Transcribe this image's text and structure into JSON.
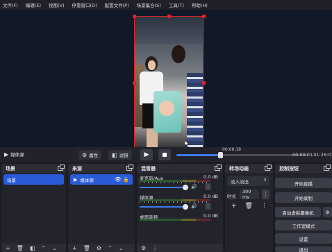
{
  "menu": [
    "文件(F)",
    "编辑(E)",
    "视图(V)",
    "停靠窗口(D)",
    "配置文件(P)",
    "场景集合(S)",
    "工具(T)",
    "帮助(H)"
  ],
  "transport": {
    "source_name": "媒体源",
    "properties_label": "属性",
    "filters_label": "滤镜",
    "hover_time": "00:00:19",
    "current_time": "00:00:01",
    "remaining_time": "-01:26:07",
    "progress": 0.33
  },
  "docks": {
    "scenes": {
      "title": "场景",
      "items": [
        "场景"
      ]
    },
    "sources": {
      "title": "来源",
      "items": [
        "媒体源"
      ]
    },
    "mixer": {
      "title": "混音器",
      "channels": [
        {
          "name": "麦克风/Aux",
          "db": "0.0 dB"
        },
        {
          "name": "媒体源",
          "db": "0.0 dB"
        },
        {
          "name": "桌面音频",
          "db": "0.0 dB"
        }
      ]
    },
    "transitions": {
      "title": "转场动画",
      "selected": "淡入淡出",
      "duration_label": "时长",
      "duration_value": "300 ms"
    },
    "controls": {
      "title": "控制按钮",
      "buttons": [
        "开始直播",
        "开始录制",
        "启动虚拟摄像机",
        "工作室模式",
        "设置",
        "退出"
      ]
    }
  },
  "colors": {
    "accent": "#3d7cf0",
    "selection": "#e2232a",
    "list_selected": "#2a5bd8"
  }
}
